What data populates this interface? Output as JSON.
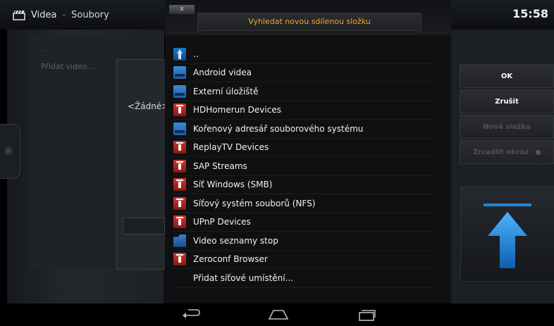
{
  "header": {
    "title": "Videa",
    "separator": "-",
    "section": "Soubory",
    "clock": "15:58"
  },
  "background": {
    "add_video": "Přidat video...",
    "dots": "..",
    "none_option": "<Žádné>"
  },
  "dialog": {
    "close_label": "x",
    "title": "Vyhledat novou sdílenou složku",
    "items": [
      {
        "label": "..",
        "icon": "up-arrow-icon"
      },
      {
        "label": "Android videa",
        "icon": "blue-drive-icon"
      },
      {
        "label": "Externí úložiště",
        "icon": "blue-drive-icon"
      },
      {
        "label": "HDHomerun Devices",
        "icon": "network-drive-icon"
      },
      {
        "label": "Kořenový adresář souborového systému",
        "icon": "blue-drive-icon"
      },
      {
        "label": "ReplayTV Devices",
        "icon": "network-drive-icon"
      },
      {
        "label": "SAP Streams",
        "icon": "network-drive-icon"
      },
      {
        "label": "Síť Windows (SMB)",
        "icon": "network-drive-icon"
      },
      {
        "label": "Síťový systém souborů (NFS)",
        "icon": "network-drive-icon"
      },
      {
        "label": "UPnP Devices",
        "icon": "network-drive-icon"
      },
      {
        "label": "Video seznamy stop",
        "icon": "folder-icon"
      },
      {
        "label": "Zeroconf Browser",
        "icon": "network-drive-icon"
      },
      {
        "label": "Přidat síťové umístění...",
        "icon": ""
      }
    ]
  },
  "actions": {
    "ok": "OK",
    "cancel": "Zrušit",
    "new_folder": "Nová složka",
    "mirror": "Zrcadlit obraz"
  },
  "colors": {
    "title_accent": "#e8a828",
    "breadcrumb_separator": "#3a8ed8",
    "arrow_blue": "#1a8ae0"
  }
}
